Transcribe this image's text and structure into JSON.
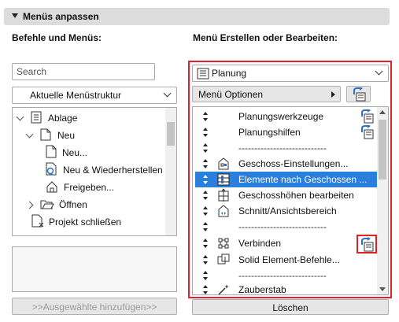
{
  "section": {
    "title": "Menüs anpassen"
  },
  "left": {
    "label": "Befehle und Menüs:",
    "search_placeholder": "Search",
    "structure_dropdown": "Aktuelle Menüstruktur",
    "tree": [
      {
        "label": "Ablage",
        "icon": "document-icon",
        "expanded": true
      },
      {
        "label": "Neu",
        "icon": "document-icon",
        "expanded": true
      },
      {
        "label": "Neu...",
        "icon": "document-icon"
      },
      {
        "label": "Neu & Wiederherstellen",
        "icon": "new-restore-icon"
      },
      {
        "label": "Freigeben...",
        "icon": "house-icon"
      },
      {
        "label": "Öffnen",
        "icon": "folder-open-icon",
        "expanded": false
      },
      {
        "label": "Projekt schließen",
        "icon": "close-doc-icon"
      }
    ],
    "add_button": ">>Ausgewählte hinzufügen>>"
  },
  "right": {
    "label": "Menü Erstellen oder Bearbeiten:",
    "menu_dropdown": "Planung",
    "options_button": "Menü Optionen",
    "items": [
      {
        "label": "Planungswerkzeuge",
        "icon": "",
        "add": true
      },
      {
        "label": "Planungshilfen",
        "icon": "",
        "add": true
      },
      {
        "label": "----------------------------",
        "icon": "",
        "separator": true
      },
      {
        "label": "Geschoss-Einstellungen...",
        "icon": "building-icon"
      },
      {
        "label": "Elemente nach Geschossen ...",
        "icon": "stories-icon",
        "selected": true
      },
      {
        "label": "Geschosshöhen bearbeiten",
        "icon": "height-icon"
      },
      {
        "label": "Schnitt/Ansichtsbereich",
        "icon": "section-icon"
      },
      {
        "label": "----------------------------",
        "icon": "",
        "separator": true
      },
      {
        "label": "Verbinden",
        "icon": "connect-icon",
        "add": true,
        "highlight": true
      },
      {
        "label": "Solid Element-Befehle...",
        "icon": "solid-icon"
      },
      {
        "label": "----------------------------",
        "icon": "",
        "separator": true
      },
      {
        "label": "Zauberstab",
        "icon": "magic-wand-icon"
      }
    ],
    "delete_button": "Löschen"
  },
  "colors": {
    "accent": "#2a7fdc",
    "highlight_frame": "#e0202a",
    "header_bg": "#dcdcdc"
  }
}
